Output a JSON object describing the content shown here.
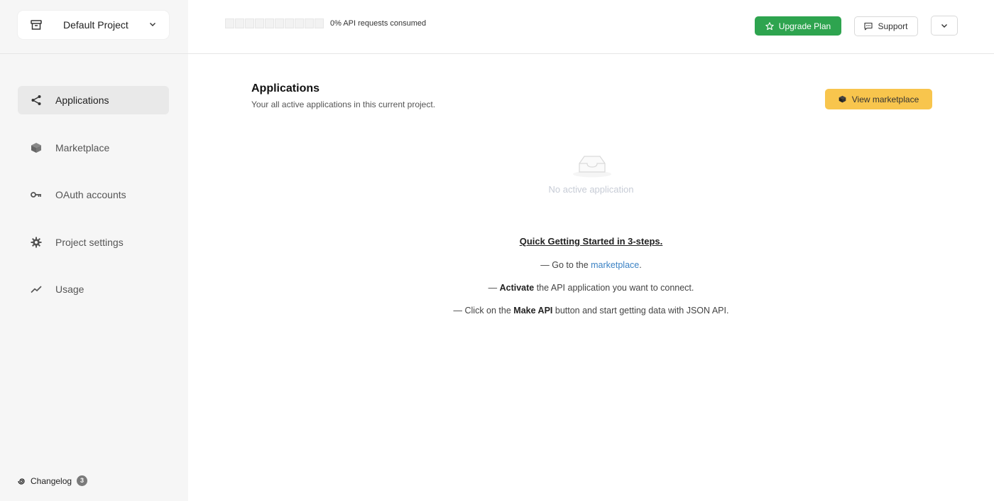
{
  "sidebar": {
    "project": {
      "label": "Default Project",
      "icon": "archive-box-icon"
    },
    "items": [
      {
        "label": "Applications",
        "icon": "share-icon",
        "active": true
      },
      {
        "label": "Marketplace",
        "icon": "cube-icon",
        "active": false
      },
      {
        "label": "OAuth accounts",
        "icon": "key-icon",
        "active": false
      },
      {
        "label": "Project settings",
        "icon": "gear-icon",
        "active": false
      },
      {
        "label": "Usage",
        "icon": "trend-line-icon",
        "active": false
      }
    ],
    "changelog": {
      "label": "Changelog",
      "count": "3"
    }
  },
  "topbar": {
    "usage_label": "0% API requests consumed",
    "usage_percent": 0,
    "upgrade_label": "Upgrade Plan",
    "support_label": "Support"
  },
  "main": {
    "title": "Applications",
    "subtitle": "Your all active applications in this current project.",
    "marketplace_button": "View marketplace",
    "empty_text": "No active application",
    "quickstart": {
      "title": "Quick Getting Started in 3-steps.",
      "step1_prefix": "— Go to the ",
      "step1_link": "marketplace",
      "step1_suffix": ".",
      "step2_prefix": "— ",
      "step2_bold": "Activate",
      "step2_suffix": " the API application you want to connect.",
      "step3_prefix": "— Click on the ",
      "step3_bold": "Make API",
      "step3_suffix": " button and start getting data with JSON API."
    }
  },
  "colors": {
    "sidebar_bg": "#f6f6f6",
    "active_item_bg": "#e9e9e9",
    "upgrade_green": "#2ea44f",
    "marketplace_yellow": "#f8c54d",
    "link_blue": "#3b82c4"
  }
}
